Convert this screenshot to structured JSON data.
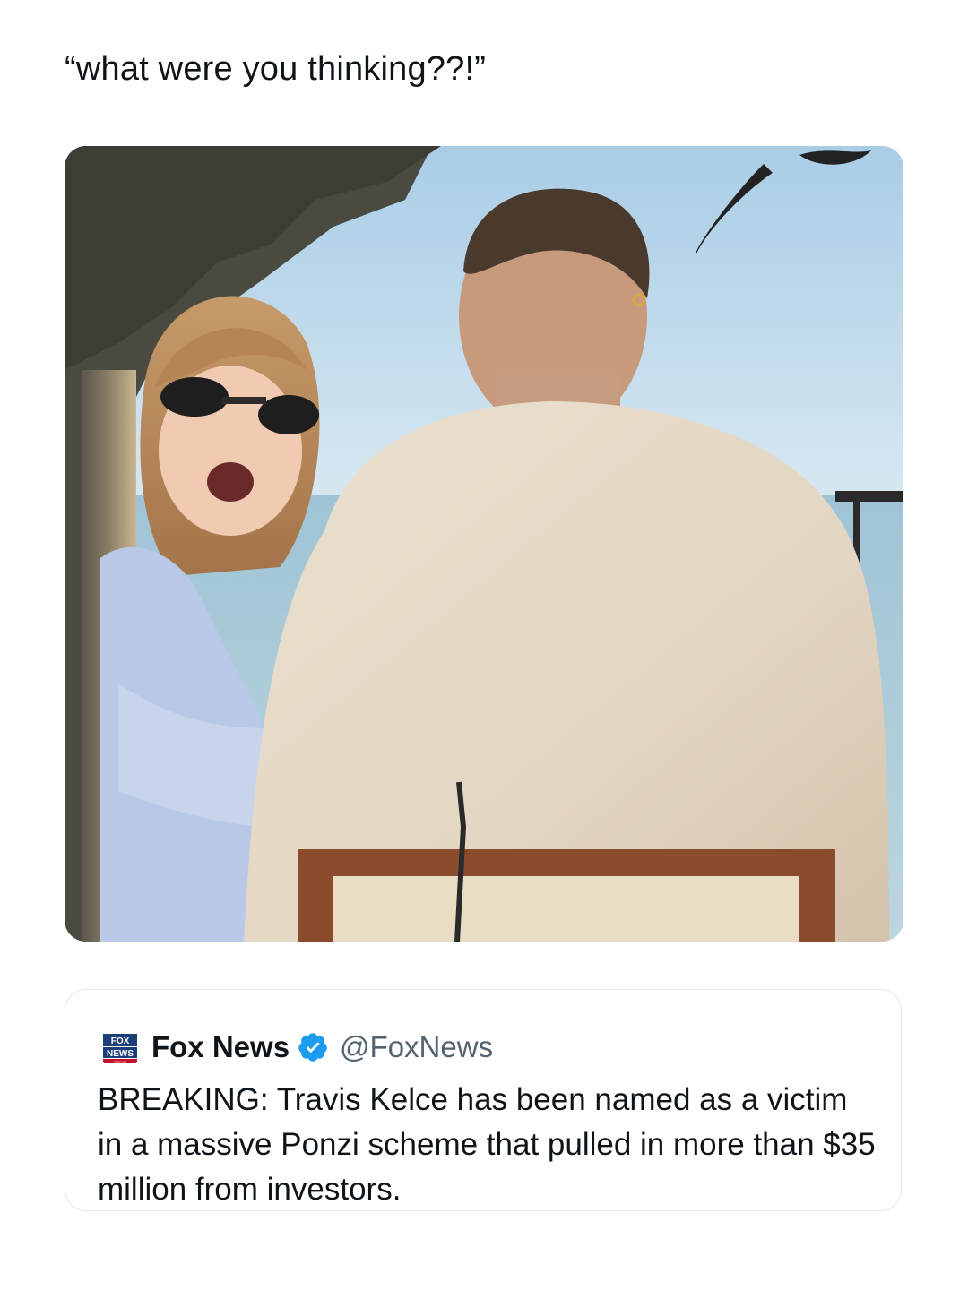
{
  "post": {
    "text": "“what were you thinking??!”"
  },
  "media": {
    "description_icon": "photo"
  },
  "quote": {
    "display_name": "Fox News",
    "handle": "@FoxNews",
    "verified_color": "#1d9bf0",
    "text": "BREAKING: Travis Kelce has been named as a victim in a massive Ponzi scheme that pulled in more than $35 million from investors.",
    "avatar_logo_line1": "FOX",
    "avatar_logo_line2": "NEWS",
    "avatar_logo_line3": "channel"
  }
}
